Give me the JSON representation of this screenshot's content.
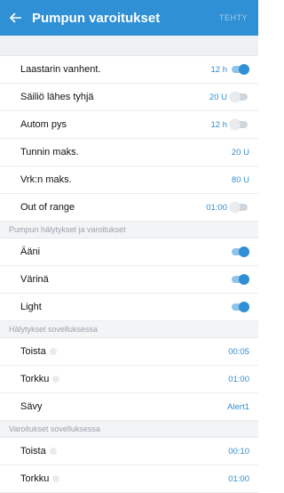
{
  "header": {
    "back_icon": "arrow-left-icon",
    "title": "Pumpun varoitukset",
    "done_label": "TEHTY"
  },
  "pump_warnings": [
    {
      "label": "Laastarin vanhent.",
      "value": "12 h",
      "toggle": true
    },
    {
      "label": "Säiliö lähes tyhjä",
      "value": "20 U",
      "toggle": false
    },
    {
      "label": "Autom pys",
      "value": "12 h",
      "toggle": false
    },
    {
      "label": "Tunnin maks.",
      "value": "20 U"
    },
    {
      "label": "Vrk:n maks.",
      "value": "80 U"
    },
    {
      "label": "Out of range",
      "value": "01:00",
      "toggle": false
    }
  ],
  "section_alarms": "Pumpun hälytykset ja varoitukset",
  "alarms": [
    {
      "label": "Ääni",
      "toggle": true
    },
    {
      "label": "Värinä",
      "toggle": true
    },
    {
      "label": "Light",
      "toggle": true
    }
  ],
  "section_app_alarms": "Hälytykset sovelluksessa",
  "app_alarms": [
    {
      "label": "Toista",
      "value": "00:05"
    },
    {
      "label": "Torkku",
      "value": "01:00"
    },
    {
      "label": "Sävy",
      "value": "Alert1"
    }
  ],
  "section_app_warnings": "Varoitukset sovelluksessa",
  "app_warnings": [
    {
      "label": "Toista",
      "value": "00:10"
    },
    {
      "label": "Torkku",
      "value": "01:00"
    }
  ],
  "colors": {
    "accent": "#2f90d6",
    "toggle_on": "#2f8ed4",
    "section_bg": "#f3f4f6"
  }
}
